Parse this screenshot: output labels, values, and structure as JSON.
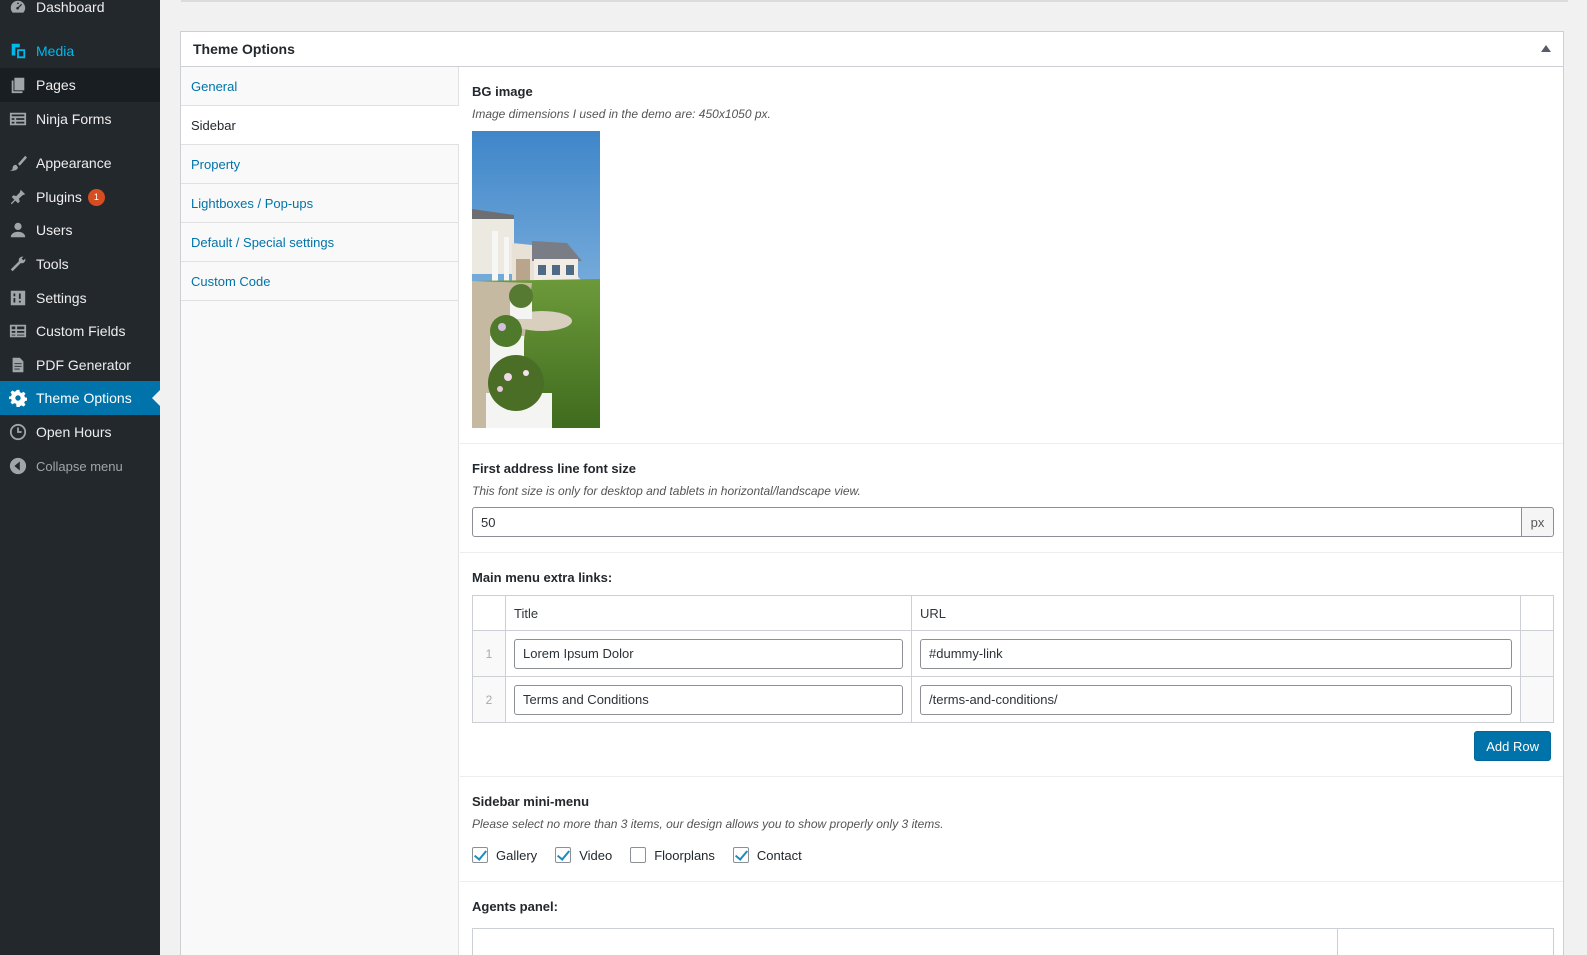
{
  "sidebar": {
    "items": [
      {
        "label": "Dashboard",
        "icon": "dashboard-icon"
      },
      {
        "label": "Media",
        "icon": "media-icon"
      },
      {
        "label": "Pages",
        "icon": "pages-icon"
      },
      {
        "label": "Ninja Forms",
        "icon": "forms-icon"
      },
      {
        "label": "Appearance",
        "icon": "brush-icon"
      },
      {
        "label": "Plugins",
        "icon": "plugin-icon",
        "badge": "1"
      },
      {
        "label": "Users",
        "icon": "user-icon"
      },
      {
        "label": "Tools",
        "icon": "wrench-icon"
      },
      {
        "label": "Settings",
        "icon": "sliders-icon"
      },
      {
        "label": "Custom Fields",
        "icon": "table-icon"
      },
      {
        "label": "PDF Generator",
        "icon": "document-icon"
      },
      {
        "label": "Theme Options",
        "icon": "gear-icon"
      },
      {
        "label": "Open Hours",
        "icon": "clock-icon"
      },
      {
        "label": "Collapse menu",
        "icon": "collapse-icon"
      }
    ]
  },
  "postbox": {
    "title": "Theme Options",
    "tabs": [
      "General",
      "Sidebar",
      "Property",
      "Lightboxes / Pop-ups",
      "Default / Special settings",
      "Custom Code"
    ],
    "active_tab": "Sidebar"
  },
  "fields": {
    "bg_image": {
      "label": "BG image",
      "desc": "Image dimensions I used in the demo are: 450x1050 px."
    },
    "font_size": {
      "label": "First address line font size",
      "desc": "This font size is only for desktop and tablets in horizontal/landscape view.",
      "value": "50",
      "append": "px"
    },
    "menu_links": {
      "label": "Main menu extra links:",
      "headers": [
        "Title",
        "URL"
      ],
      "rows": [
        {
          "order": "1",
          "title": "Lorem Ipsum Dolor",
          "url": "#dummy-link"
        },
        {
          "order": "2",
          "title": "Terms and Conditions",
          "url": "/terms-and-conditions/"
        }
      ],
      "add_button": "Add Row"
    },
    "mini_menu": {
      "label": "Sidebar mini-menu",
      "desc": "Please select no more than 3 items, our design allows you to show properly only 3 items.",
      "options": [
        {
          "label": "Gallery",
          "checked": true
        },
        {
          "label": "Video",
          "checked": true
        },
        {
          "label": "Floorplans",
          "checked": false
        },
        {
          "label": "Contact",
          "checked": true
        }
      ]
    },
    "agents": {
      "label": "Agents panel:"
    }
  }
}
